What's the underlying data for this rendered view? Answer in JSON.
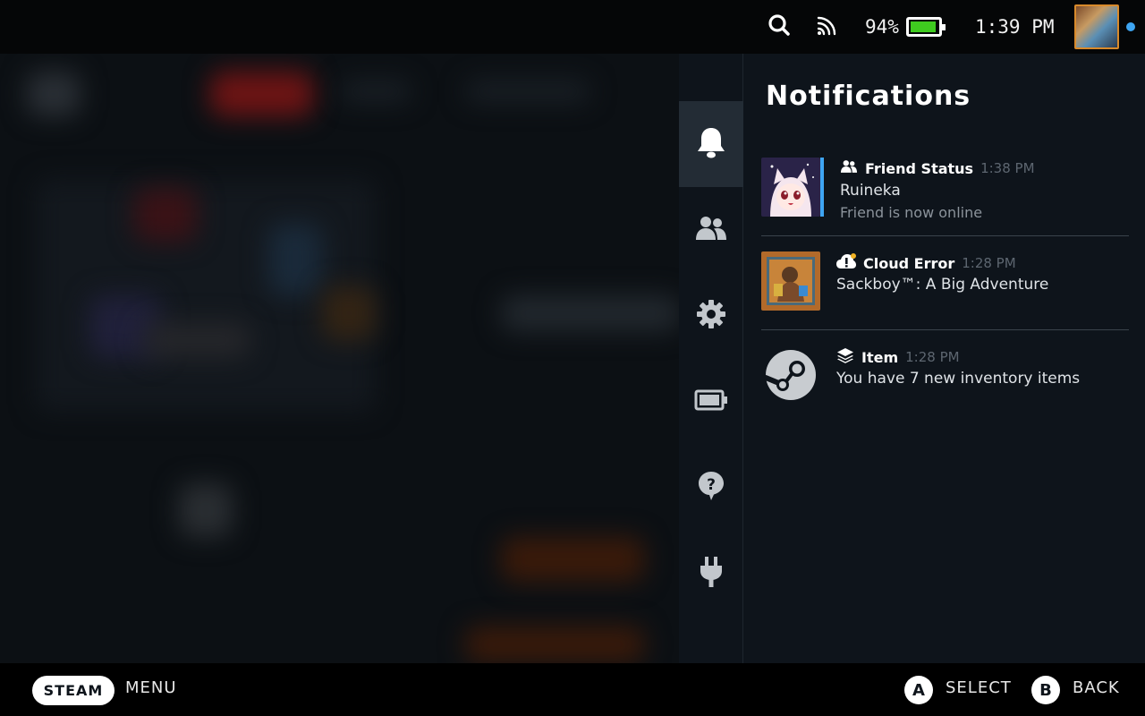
{
  "topbar": {
    "battery_percent_label": "94%",
    "battery_level": 0.94,
    "time": "1:39 PM",
    "icons": [
      "search-icon",
      "wifi-icon",
      "battery-icon"
    ],
    "online_color": "#3ea5f2"
  },
  "rail": {
    "items": [
      {
        "icon": "bell-icon",
        "active": true
      },
      {
        "icon": "friends-icon",
        "active": false
      },
      {
        "icon": "gear-icon",
        "active": false
      },
      {
        "icon": "battery-icon",
        "active": false
      },
      {
        "icon": "help-icon",
        "active": false
      },
      {
        "icon": "plug-icon",
        "active": false
      }
    ]
  },
  "panel": {
    "title": "Notifications",
    "notifications": [
      {
        "type": "Friend Status",
        "time": "1:38 PM",
        "line1": "Ruineka",
        "line2": "Friend is now online",
        "icon": "friends-icon",
        "unread": true
      },
      {
        "type": "Cloud Error",
        "time": "1:28 PM",
        "line1": "Sackboy™: A Big Adventure",
        "line2": "",
        "icon": "cloud-error-icon",
        "unread": false
      },
      {
        "type": "Item",
        "time": "1:28 PM",
        "line1": "You have 7 new inventory items",
        "line2": "",
        "icon": "layers-icon",
        "unread": false
      }
    ]
  },
  "bottombar": {
    "steam_label": "STEAM",
    "menu_label": "MENU",
    "a_key": "A",
    "select_label": "SELECT",
    "b_key": "B",
    "back_label": "BACK"
  },
  "colors": {
    "panel_bg": "#0e141b",
    "accent": "#3ea5f2",
    "battery_green": "#3fcb1f"
  }
}
